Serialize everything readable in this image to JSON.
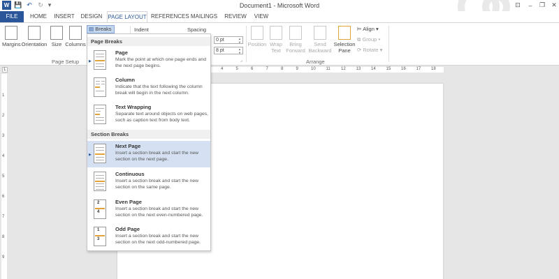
{
  "window": {
    "title": "Document1 - Microsoft Word",
    "help": "?",
    "restore_ribbon": "⊡",
    "minimize": "–",
    "maximize": "❐",
    "close": "✕"
  },
  "quick_access": {
    "word_icon": "W",
    "save": "💾",
    "undo": "↶",
    "redo": "↻",
    "customize": "▾"
  },
  "tabs": [
    {
      "label": "FILE"
    },
    {
      "label": "HOME"
    },
    {
      "label": "INSERT"
    },
    {
      "label": "DESIGN"
    },
    {
      "label": "PAGE LAYOUT"
    },
    {
      "label": "REFERENCES"
    },
    {
      "label": "MAILINGS"
    },
    {
      "label": "REVIEW"
    },
    {
      "label": "VIEW"
    }
  ],
  "ribbon": {
    "page_setup": {
      "margins": "Margins",
      "orientation": "Orientation",
      "size": "Size",
      "columns": "Columns",
      "breaks": "Breaks",
      "group_label": "Page Setup"
    },
    "paragraph": {
      "indent": "Indent",
      "spacing": "Spacing",
      "spacing_before": "0 pt",
      "spacing_after": "8 pt"
    },
    "arrange": {
      "position": "Position",
      "wrap_text_1": "Wrap",
      "wrap_text_2": "Text",
      "bring_forward_1": "Bring",
      "bring_forward_2": "Forward",
      "send_backward_1": "Send",
      "send_backward_2": "Backward",
      "selection_pane_1": "Selection",
      "selection_pane_2": "Pane",
      "align": "Align",
      "group": "Group",
      "rotate": "Rotate",
      "group_label": "Arrange"
    }
  },
  "ruler": {
    "tab_selector": "L",
    "numbers": [
      "4",
      "5",
      "6",
      "7",
      "8",
      "9",
      "10",
      "11",
      "12",
      "13",
      "14",
      "15",
      "16",
      "17",
      "18"
    ],
    "vnumbers": [
      "1",
      "2",
      "3",
      "4",
      "5",
      "6",
      "7",
      "8",
      "9"
    ]
  },
  "breaks_menu": {
    "page_breaks_header": "Page Breaks",
    "section_breaks_header": "Section Breaks",
    "items": [
      {
        "title": "Page",
        "desc": "Mark the point at which one page ends and the next page begins."
      },
      {
        "title": "Column",
        "desc": "Indicate that the text following the column break will begin in the next column."
      },
      {
        "title": "Text Wrapping",
        "desc": "Separate text around objects on web pages, such as caption text from body text."
      },
      {
        "title": "Next Page",
        "desc": "Insert a section break and start the new section on the next page."
      },
      {
        "title": "Continuous",
        "desc": "Insert a section break and start the new section on the same page."
      },
      {
        "title": "Even Page",
        "desc": "Insert a section break and start the new section on the next even-numbered page.",
        "num_a": "2",
        "num_b": "4"
      },
      {
        "title": "Odd Page",
        "desc": "Insert a section break and start the new section on the next odd-numbered page.",
        "num_a": "1",
        "num_b": "3"
      }
    ]
  }
}
